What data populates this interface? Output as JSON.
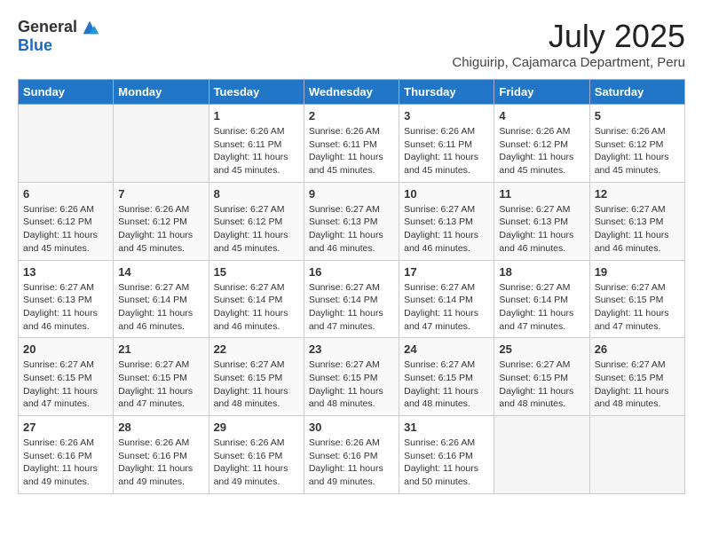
{
  "header": {
    "logo_general": "General",
    "logo_blue": "Blue",
    "month_title": "July 2025",
    "subtitle": "Chiguirip, Cajamarca Department, Peru"
  },
  "weekdays": [
    "Sunday",
    "Monday",
    "Tuesday",
    "Wednesday",
    "Thursday",
    "Friday",
    "Saturday"
  ],
  "weeks": [
    [
      {
        "day": "",
        "info": ""
      },
      {
        "day": "",
        "info": ""
      },
      {
        "day": "1",
        "info": "Sunrise: 6:26 AM\nSunset: 6:11 PM\nDaylight: 11 hours and 45 minutes."
      },
      {
        "day": "2",
        "info": "Sunrise: 6:26 AM\nSunset: 6:11 PM\nDaylight: 11 hours and 45 minutes."
      },
      {
        "day": "3",
        "info": "Sunrise: 6:26 AM\nSunset: 6:11 PM\nDaylight: 11 hours and 45 minutes."
      },
      {
        "day": "4",
        "info": "Sunrise: 6:26 AM\nSunset: 6:12 PM\nDaylight: 11 hours and 45 minutes."
      },
      {
        "day": "5",
        "info": "Sunrise: 6:26 AM\nSunset: 6:12 PM\nDaylight: 11 hours and 45 minutes."
      }
    ],
    [
      {
        "day": "6",
        "info": "Sunrise: 6:26 AM\nSunset: 6:12 PM\nDaylight: 11 hours and 45 minutes."
      },
      {
        "day": "7",
        "info": "Sunrise: 6:26 AM\nSunset: 6:12 PM\nDaylight: 11 hours and 45 minutes."
      },
      {
        "day": "8",
        "info": "Sunrise: 6:27 AM\nSunset: 6:12 PM\nDaylight: 11 hours and 45 minutes."
      },
      {
        "day": "9",
        "info": "Sunrise: 6:27 AM\nSunset: 6:13 PM\nDaylight: 11 hours and 46 minutes."
      },
      {
        "day": "10",
        "info": "Sunrise: 6:27 AM\nSunset: 6:13 PM\nDaylight: 11 hours and 46 minutes."
      },
      {
        "day": "11",
        "info": "Sunrise: 6:27 AM\nSunset: 6:13 PM\nDaylight: 11 hours and 46 minutes."
      },
      {
        "day": "12",
        "info": "Sunrise: 6:27 AM\nSunset: 6:13 PM\nDaylight: 11 hours and 46 minutes."
      }
    ],
    [
      {
        "day": "13",
        "info": "Sunrise: 6:27 AM\nSunset: 6:13 PM\nDaylight: 11 hours and 46 minutes."
      },
      {
        "day": "14",
        "info": "Sunrise: 6:27 AM\nSunset: 6:14 PM\nDaylight: 11 hours and 46 minutes."
      },
      {
        "day": "15",
        "info": "Sunrise: 6:27 AM\nSunset: 6:14 PM\nDaylight: 11 hours and 46 minutes."
      },
      {
        "day": "16",
        "info": "Sunrise: 6:27 AM\nSunset: 6:14 PM\nDaylight: 11 hours and 47 minutes."
      },
      {
        "day": "17",
        "info": "Sunrise: 6:27 AM\nSunset: 6:14 PM\nDaylight: 11 hours and 47 minutes."
      },
      {
        "day": "18",
        "info": "Sunrise: 6:27 AM\nSunset: 6:14 PM\nDaylight: 11 hours and 47 minutes."
      },
      {
        "day": "19",
        "info": "Sunrise: 6:27 AM\nSunset: 6:15 PM\nDaylight: 11 hours and 47 minutes."
      }
    ],
    [
      {
        "day": "20",
        "info": "Sunrise: 6:27 AM\nSunset: 6:15 PM\nDaylight: 11 hours and 47 minutes."
      },
      {
        "day": "21",
        "info": "Sunrise: 6:27 AM\nSunset: 6:15 PM\nDaylight: 11 hours and 47 minutes."
      },
      {
        "day": "22",
        "info": "Sunrise: 6:27 AM\nSunset: 6:15 PM\nDaylight: 11 hours and 48 minutes."
      },
      {
        "day": "23",
        "info": "Sunrise: 6:27 AM\nSunset: 6:15 PM\nDaylight: 11 hours and 48 minutes."
      },
      {
        "day": "24",
        "info": "Sunrise: 6:27 AM\nSunset: 6:15 PM\nDaylight: 11 hours and 48 minutes."
      },
      {
        "day": "25",
        "info": "Sunrise: 6:27 AM\nSunset: 6:15 PM\nDaylight: 11 hours and 48 minutes."
      },
      {
        "day": "26",
        "info": "Sunrise: 6:27 AM\nSunset: 6:15 PM\nDaylight: 11 hours and 48 minutes."
      }
    ],
    [
      {
        "day": "27",
        "info": "Sunrise: 6:26 AM\nSunset: 6:16 PM\nDaylight: 11 hours and 49 minutes."
      },
      {
        "day": "28",
        "info": "Sunrise: 6:26 AM\nSunset: 6:16 PM\nDaylight: 11 hours and 49 minutes."
      },
      {
        "day": "29",
        "info": "Sunrise: 6:26 AM\nSunset: 6:16 PM\nDaylight: 11 hours and 49 minutes."
      },
      {
        "day": "30",
        "info": "Sunrise: 6:26 AM\nSunset: 6:16 PM\nDaylight: 11 hours and 49 minutes."
      },
      {
        "day": "31",
        "info": "Sunrise: 6:26 AM\nSunset: 6:16 PM\nDaylight: 11 hours and 50 minutes."
      },
      {
        "day": "",
        "info": ""
      },
      {
        "day": "",
        "info": ""
      }
    ]
  ]
}
